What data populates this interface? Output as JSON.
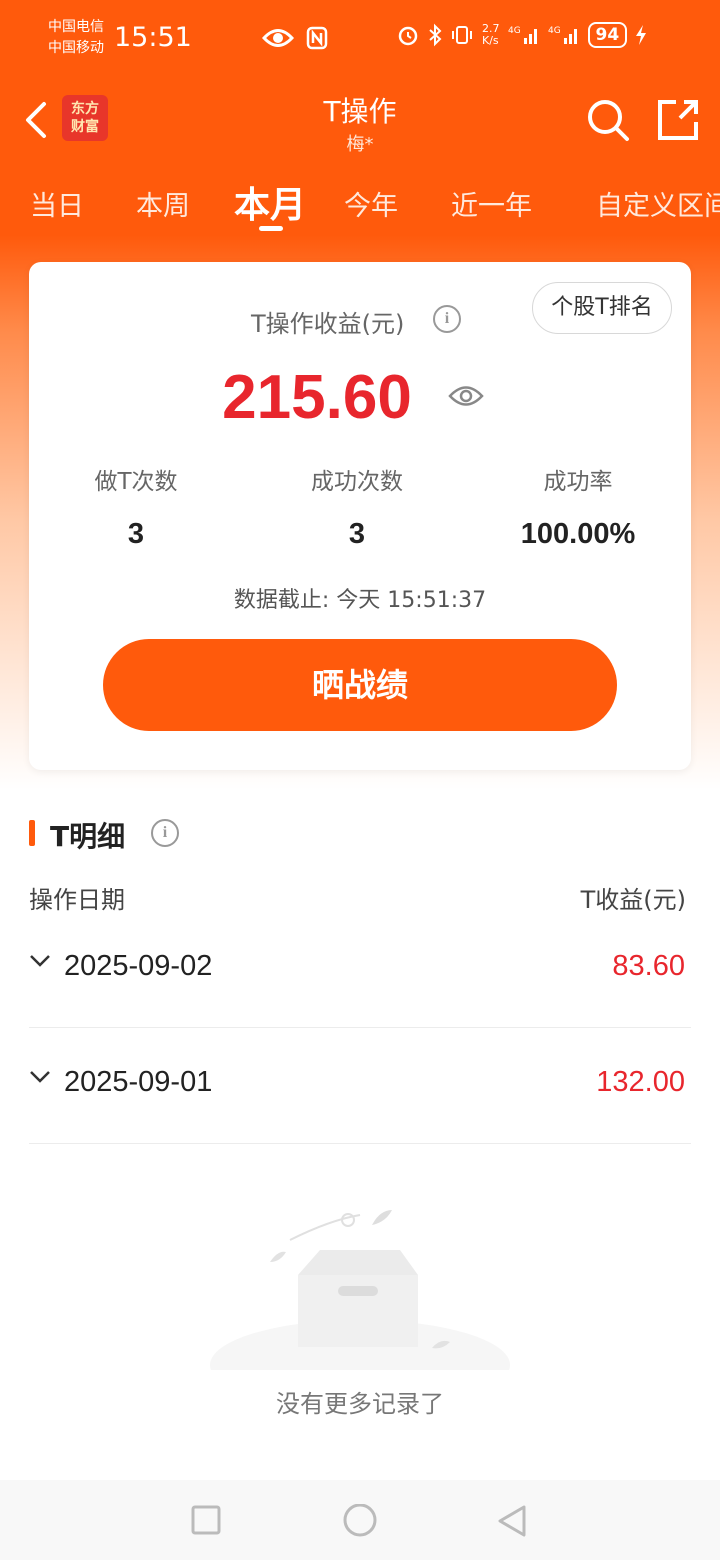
{
  "status_bar": {
    "carrier_1": "中国电信",
    "carrier_2": "中国移动",
    "time": "15:51",
    "net_speed": "2.7\nK/s",
    "battery": "94"
  },
  "header": {
    "logo_text": "东方财富",
    "title": "T操作",
    "subtitle": "梅*"
  },
  "tabs": [
    {
      "label": "当日"
    },
    {
      "label": "本周"
    },
    {
      "label": "本月",
      "active": true
    },
    {
      "label": "今年"
    },
    {
      "label": "近一年"
    },
    {
      "label": "自定义区间"
    }
  ],
  "card": {
    "profit_label": "T操作收益(元)",
    "rank_button": "个股T排名",
    "profit_amount": "215.60",
    "stats": [
      {
        "label": "做T次数",
        "value": "3"
      },
      {
        "label": "成功次数",
        "value": "3"
      },
      {
        "label": "成功率",
        "value": "100.00%"
      }
    ],
    "data_time": "数据截止: 今天 15:51:37",
    "share_button": "晒战绩"
  },
  "detail": {
    "title": "T明细",
    "col_date": "操作日期",
    "col_profit": "T收益(元)",
    "rows": [
      {
        "date": "2025-09-02",
        "profit": "83.60"
      },
      {
        "date": "2025-09-01",
        "profit": "132.00"
      }
    ],
    "empty_text": "没有更多记录了"
  },
  "colors": {
    "brand": "#ff5a0c",
    "profit_red": "#e8262d"
  }
}
